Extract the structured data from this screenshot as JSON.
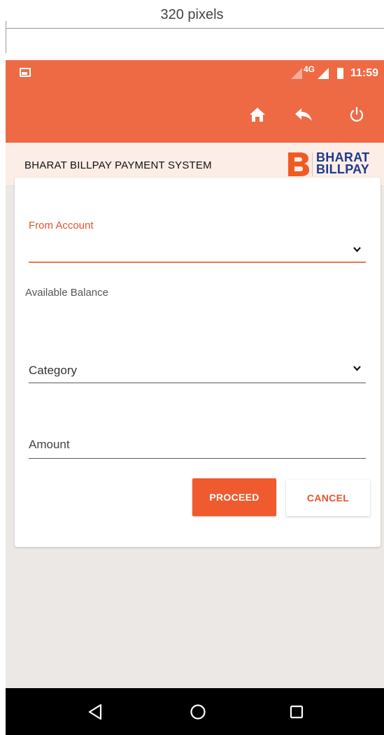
{
  "annotation": {
    "width_label": "320 pixels"
  },
  "status_bar": {
    "network": "4G",
    "time": "11:59"
  },
  "app_bar": {
    "icons": [
      "home-icon",
      "reply-back-icon",
      "power-icon"
    ],
    "color": "#ee6a45"
  },
  "brand": {
    "title": "BHARAT BILLPAY PAYMENT SYSTEM",
    "logo_line1": "BHARAT",
    "logo_line2": "BILLPAY",
    "logo_colors": {
      "b": "#f15a22",
      "text": "#1e3a8a"
    }
  },
  "form": {
    "from_account_label": "From Account",
    "from_account_value": "",
    "available_balance_label": "Available Balance",
    "category_placeholder": "Category",
    "amount_placeholder": "Amount",
    "proceed_label": "PROCEED",
    "cancel_label": "CANCEL",
    "accent_color": "#ef5a2e"
  },
  "nav_bar": {
    "icons": [
      "back-triangle-icon",
      "home-circle-icon",
      "recents-square-icon"
    ]
  }
}
